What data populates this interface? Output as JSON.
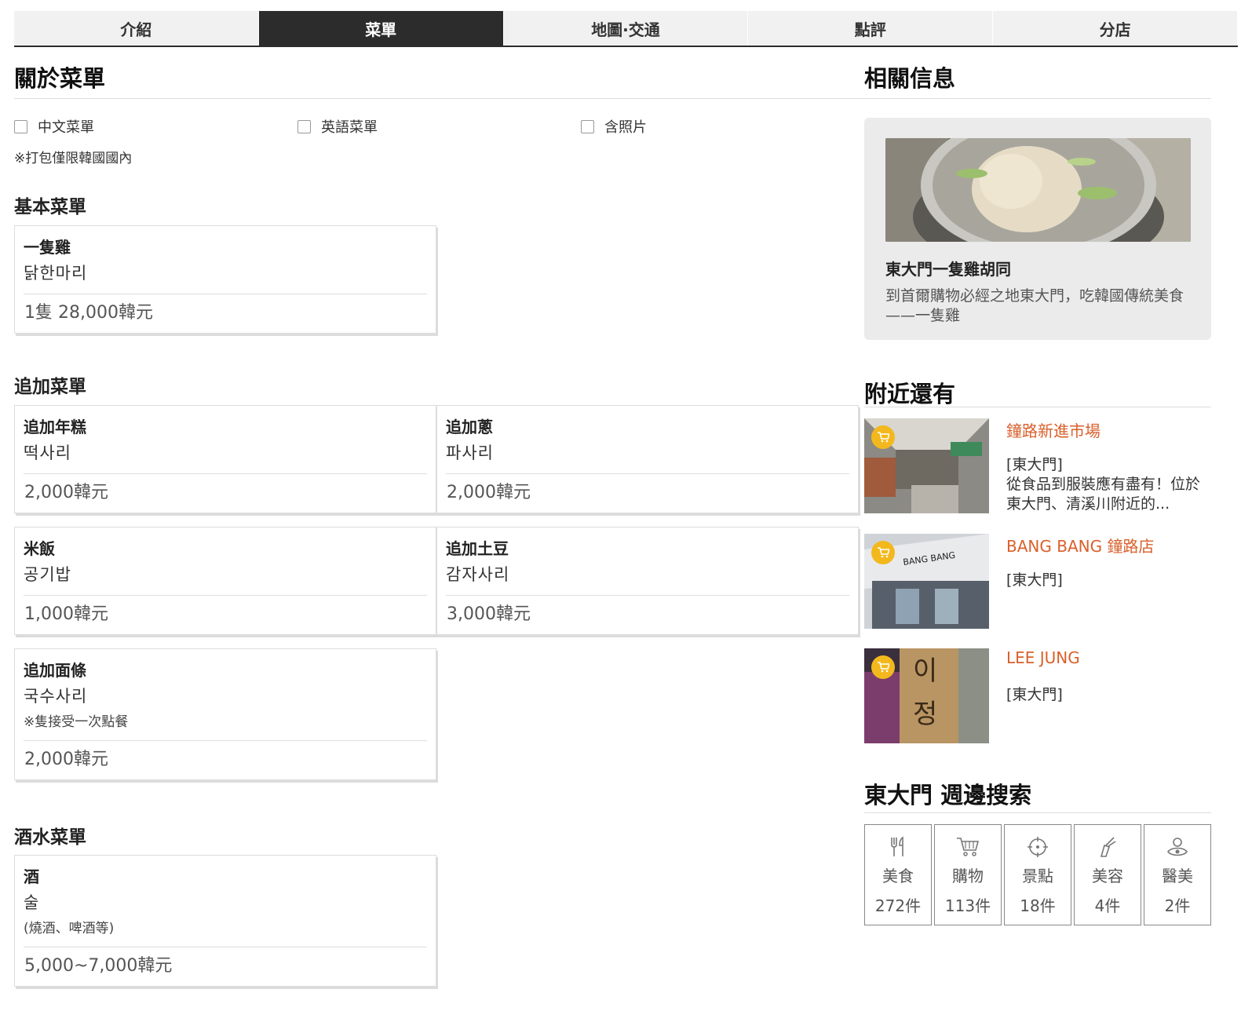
{
  "tabs": [
    "介紹",
    "菜單",
    "地圖·交通",
    "點評",
    "分店"
  ],
  "menu_about": {
    "title": "關於菜單",
    "filters": [
      "中文菜單",
      "英語菜單",
      "含照片"
    ],
    "note": "※打包僅限韓國國內"
  },
  "sections": {
    "basic": "基本菜單",
    "extra": "追加菜單",
    "drinks": "酒水菜單"
  },
  "items": {
    "chicken": {
      "name": "一隻雞",
      "ko": "닭한마리",
      "price": "1隻 28,000韓元"
    },
    "rice_cake": {
      "name": "追加年糕",
      "ko": "떡사리",
      "price": "2,000韓元"
    },
    "scallion": {
      "name": "追加蔥",
      "ko": "파사리",
      "price": "2,000韓元"
    },
    "rice": {
      "name": "米飯",
      "ko": "공기밥",
      "price": "1,000韓元"
    },
    "potato": {
      "name": "追加土豆",
      "ko": "감자사리",
      "price": "3,000韓元"
    },
    "noodle": {
      "name": "追加面條",
      "ko": "국수사리",
      "sub": "※隻接受一次點餐",
      "price": "2,000韓元"
    },
    "alcohol": {
      "name": "酒",
      "ko": "술",
      "sub": "(燒酒、啤酒等)",
      "price": "5,000~7,000韓元"
    }
  },
  "related": {
    "title": "相關信息",
    "card_title": "東大門一隻雞胡同",
    "card_desc": "到首爾購物必經之地東大門，吃韓國傳統美食——一隻雞"
  },
  "nearby": {
    "title": "附近還有",
    "items": [
      {
        "name": "鐘路新進市場",
        "area": "[東大門]",
        "desc": "從食品到服裝應有盡有！位於東大門、清溪川附近的..."
      },
      {
        "name": "BANG BANG 鐘路店",
        "area": "[東大門]",
        "desc": ""
      },
      {
        "name": "LEE JUNG",
        "area": "[東大門]",
        "desc": ""
      }
    ]
  },
  "search": {
    "title": "東大門 週邊搜索",
    "categories": [
      {
        "icon": "fork-knife-icon",
        "label": "美食",
        "count": "272件"
      },
      {
        "icon": "cart-icon",
        "label": "購物",
        "count": "113件"
      },
      {
        "icon": "target-icon",
        "label": "景點",
        "count": "18件"
      },
      {
        "icon": "beauty-icon",
        "label": "美容",
        "count": "4件"
      },
      {
        "icon": "medical-icon",
        "label": "醫美",
        "count": "2件"
      }
    ]
  },
  "colors": {
    "accent": "#d9602b",
    "tab_active": "#2c2c2c",
    "badge": "#f3b81d"
  }
}
